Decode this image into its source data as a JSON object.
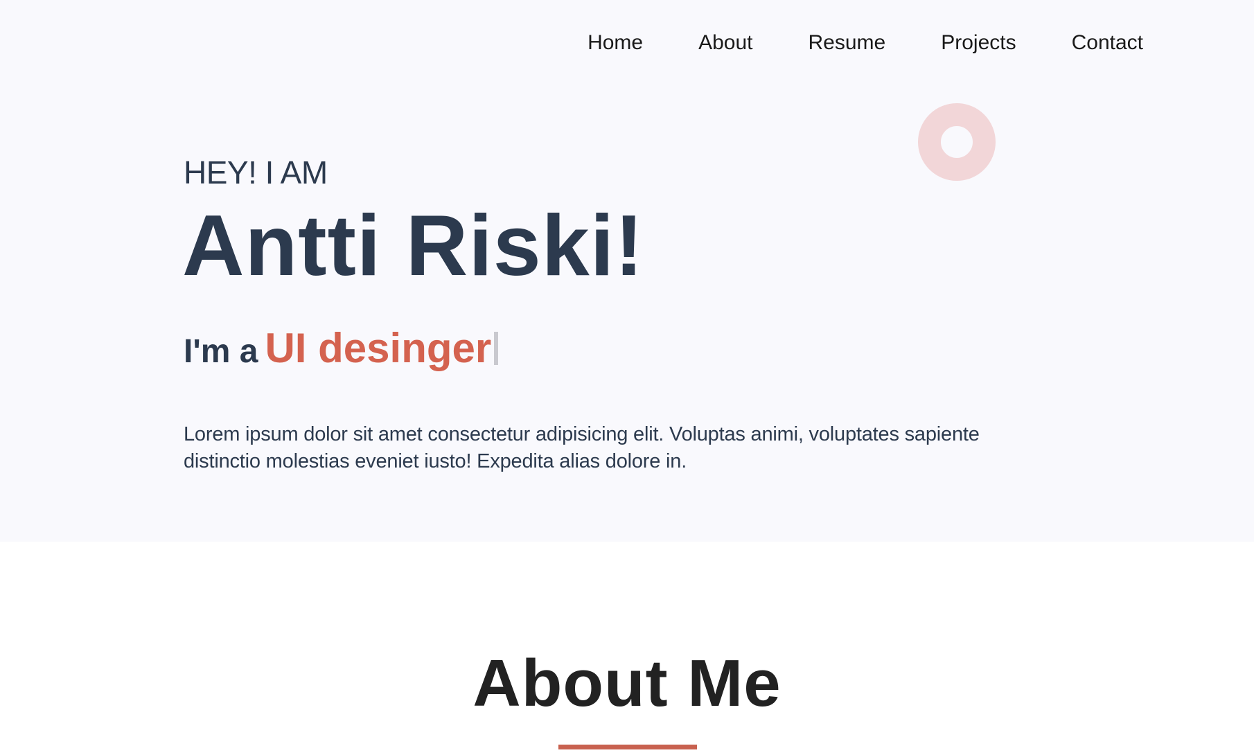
{
  "nav": {
    "items": [
      {
        "label": "Home"
      },
      {
        "label": "About"
      },
      {
        "label": "Resume"
      },
      {
        "label": "Projects"
      },
      {
        "label": "Contact"
      }
    ]
  },
  "hero": {
    "greeting": "HEY! I AM",
    "name": "Antti Riski!",
    "role_prefix": "I'm a",
    "role_value": "UI desinger",
    "intro": "Lorem ipsum dolor sit amet consectetur adipisicing elit. Voluptas animi, voluptates sapiente distinctio molestias eveniet iusto! Expedita alias dolore in."
  },
  "about": {
    "title": "About Me"
  },
  "colors": {
    "hero_background": "#f9f9fd",
    "heading_text": "#2c3a4e",
    "accent": "#d4624f",
    "ring_decoration": "#f2d6d8",
    "underline": "#c8614f"
  }
}
